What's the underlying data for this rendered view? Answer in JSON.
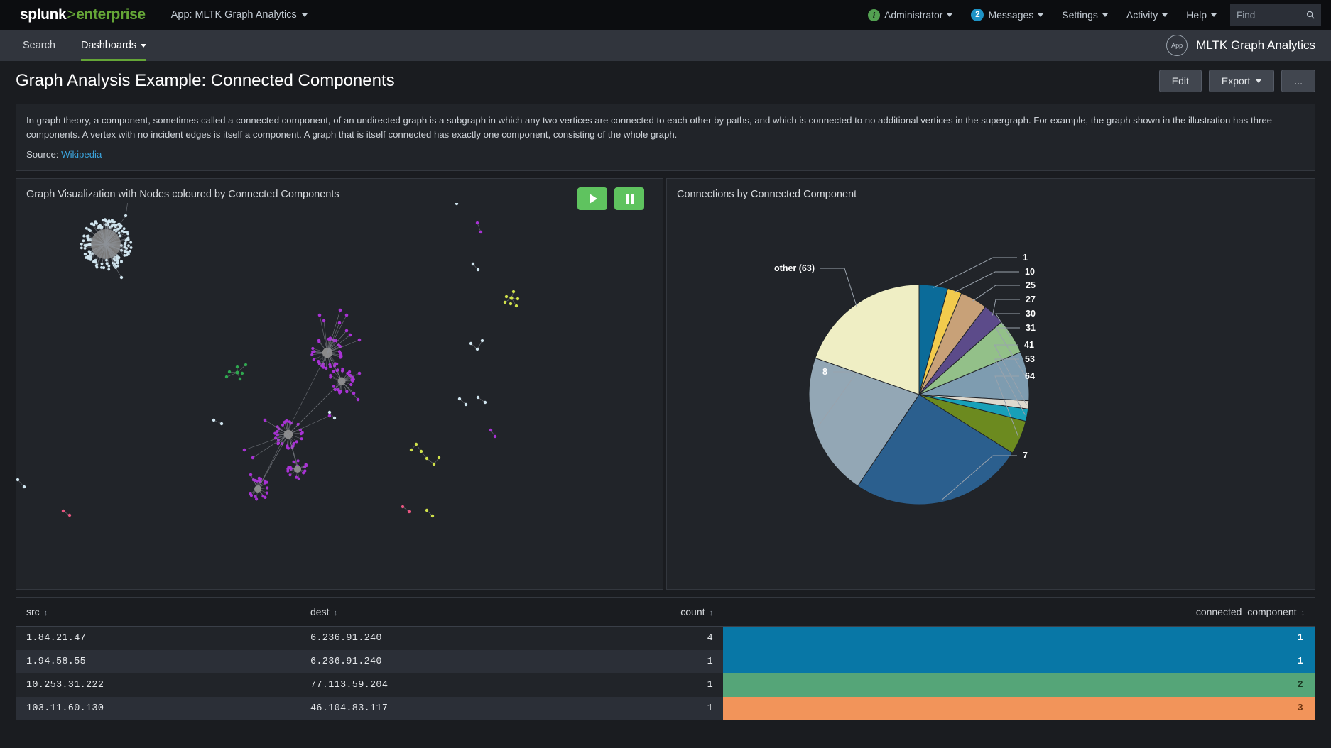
{
  "topbar": {
    "logo": {
      "splunk": "splunk",
      "arrow": ">",
      "enterprise": "enterprise"
    },
    "app_menu": "App: MLTK Graph Analytics",
    "items": [
      {
        "label": "Administrator",
        "badge": "i",
        "badge_type": "info"
      },
      {
        "label": "Messages",
        "badge": "2",
        "badge_type": "count"
      },
      {
        "label": "Settings",
        "badge": null
      },
      {
        "label": "Activity",
        "badge": null
      },
      {
        "label": "Help",
        "badge": null
      }
    ],
    "find_placeholder": "Find"
  },
  "appbar": {
    "nav": [
      {
        "label": "Search",
        "active": false,
        "caret": false
      },
      {
        "label": "Dashboards",
        "active": true,
        "caret": true
      }
    ],
    "app_badge_label": "App",
    "app_name": "MLTK Graph Analytics"
  },
  "page": {
    "title": "Graph Analysis Example: Connected Components",
    "actions": [
      {
        "label": "Edit",
        "caret": false
      },
      {
        "label": "Export",
        "caret": true
      },
      {
        "label": "...",
        "caret": false
      }
    ]
  },
  "description": {
    "body": "In graph theory, a component, sometimes called a connected component, of an undirected graph is a subgraph in which any two vertices are connected to each other by paths, and which is connected to no additional vertices in the supergraph. For example, the graph shown in the illustration has three components. A vertex with no incident edges is itself a component. A graph that is itself connected has exactly one component, consisting of the whole graph.",
    "source_label": "Source:",
    "source_link": "Wikipedia"
  },
  "panels": {
    "graph": {
      "title": "Graph Visualization with Nodes coloured by Connected Components",
      "play_label": "play",
      "pause_label": "pause"
    },
    "pie": {
      "title": "Connections by Connected Component"
    }
  },
  "chart_data": {
    "type": "pie",
    "title": "Connections by Connected Component",
    "labels": [
      "1",
      "10",
      "25",
      "27",
      "30",
      "31",
      "41",
      "53",
      "64",
      "7",
      "8",
      "other (63)"
    ],
    "values": [
      4.2,
      2.1,
      4.0,
      3.2,
      5.2,
      7.2,
      1.2,
      1.8,
      5.0,
      25.5,
      21.0,
      19.6
    ],
    "colors": [
      "#0b6b99",
      "#f2cb4d",
      "#c8a178",
      "#5c4b8a",
      "#93c089",
      "#7e9cb0",
      "#ded9ce",
      "#18a0b8",
      "#6c8a1f",
      "#2b5f8e",
      "#93a7b5",
      "#efeec4"
    ],
    "legend": "callout-labels",
    "start_angle": 90,
    "direction": "clockwise"
  },
  "table": {
    "columns": [
      {
        "key": "src",
        "label": "src",
        "align": "left"
      },
      {
        "key": "dest",
        "label": "dest",
        "align": "left"
      },
      {
        "key": "count",
        "label": "count",
        "align": "right"
      },
      {
        "key": "connected_component",
        "label": "connected_component",
        "align": "right"
      }
    ],
    "sort_icon": "↕",
    "rows": [
      {
        "src": "1.84.21.47",
        "dest": "6.236.91.240",
        "count": "4",
        "connected_component": "1",
        "cc_color": "#0877a6",
        "cc_text": "#ffffff"
      },
      {
        "src": "1.94.58.55",
        "dest": "6.236.91.240",
        "count": "1",
        "connected_component": "1",
        "cc_color": "#0877a6",
        "cc_text": "#ffffff"
      },
      {
        "src": "10.253.31.222",
        "dest": "77.113.59.204",
        "count": "1",
        "connected_component": "2",
        "cc_color": "#55a578",
        "cc_text": "#19351f"
      },
      {
        "src": "103.11.60.130",
        "dest": "46.104.83.117",
        "count": "1",
        "connected_component": "3",
        "cc_color": "#f2945a",
        "cc_text": "#6b3310"
      }
    ]
  }
}
